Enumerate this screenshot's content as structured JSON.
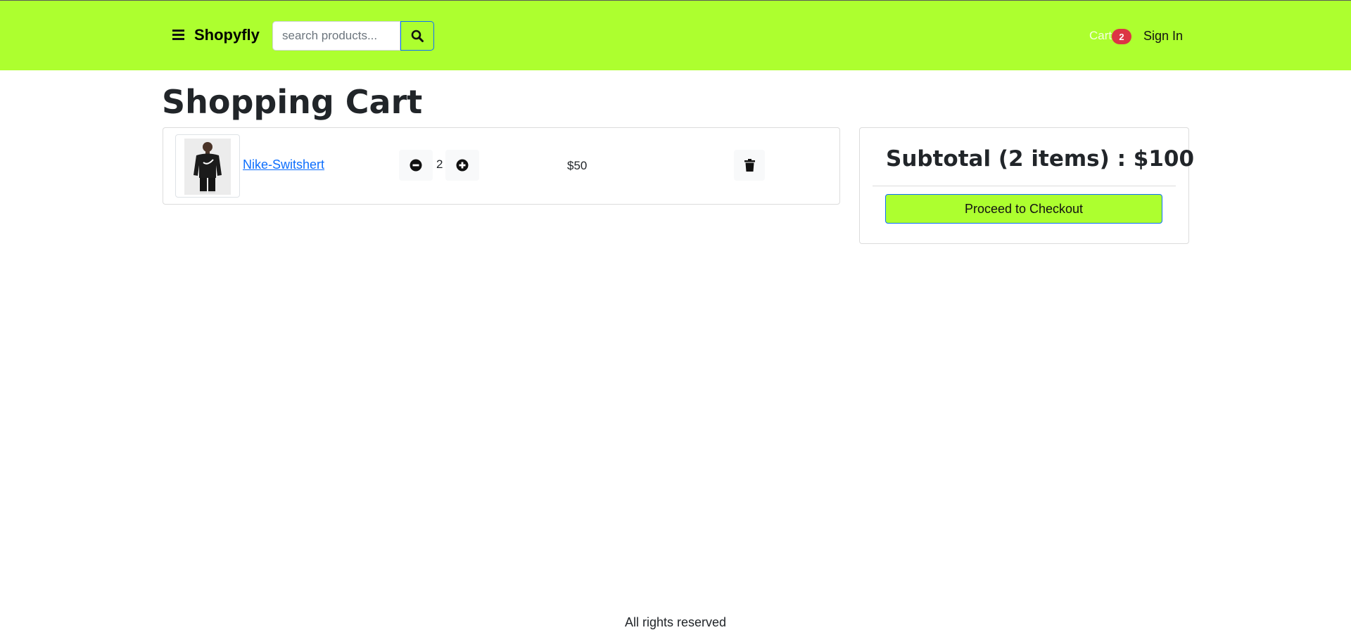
{
  "header": {
    "brand": "Shopyfly",
    "search_placeholder": "search products...",
    "cart_label": "Cart",
    "cart_count": "2",
    "signin_label": "Sign In",
    "background_color": "#adff2f"
  },
  "page": {
    "title": "Shopping Cart"
  },
  "cart": {
    "items": [
      {
        "name": "Nike-Switshert",
        "quantity": "2",
        "price": "$50"
      }
    ]
  },
  "summary": {
    "subtotal": "Subtotal (2 items) : $100",
    "checkout_label": "Proceed to Checkout"
  },
  "footer": {
    "text": "All rights reserved"
  },
  "icons": [
    "menu-icon",
    "search-icon",
    "minus-circle-icon",
    "plus-circle-icon",
    "trash-icon"
  ],
  "colors": {
    "accent": "#adff2f",
    "link": "#0d6efd",
    "badge": "#dc3545"
  }
}
